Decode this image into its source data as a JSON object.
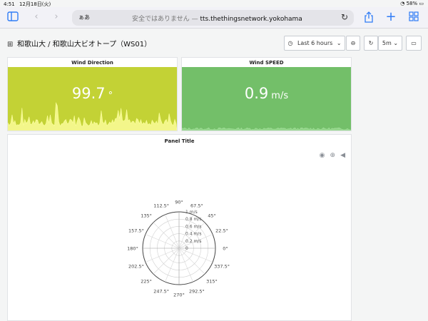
{
  "status_bar": {
    "time": "4:51",
    "date": "12月18日(火)",
    "battery": "58%"
  },
  "browser": {
    "aa_label": "ぁあ",
    "security_warning": "安全ではありません",
    "separator": " — ",
    "domain": "tts.thethingsnetwork.yokohama"
  },
  "dashboard": {
    "breadcrumb_folder": "和歌山大",
    "breadcrumb_sep": " / ",
    "breadcrumb_title": "和歌山大ビオトープ（WS01）",
    "time_range": "Last 6 hours",
    "refresh_interval": "5m"
  },
  "panels": {
    "wind_direction": {
      "title": "Wind Direction",
      "value": "99.7",
      "unit": "°",
      "color": "#c3d235"
    },
    "wind_speed": {
      "title": "Wind SPEED",
      "value": "0.9",
      "unit": "m/s",
      "color": "#73bf69"
    },
    "polar": {
      "title": "Panel Title",
      "angle_labels": [
        "0°",
        "22.5°",
        "45°",
        "67.5°",
        "90°",
        "112.5°",
        "135°",
        "157.5°",
        "180°",
        "202.5°",
        "225°",
        "247.5°",
        "270°",
        "292.5°",
        "315°",
        "337.5°"
      ],
      "radial_labels": [
        "0",
        "0.2 m/s",
        "0.4 m/s",
        "0.6 m/s",
        "0.8 m/s",
        "1 m/s"
      ]
    }
  }
}
